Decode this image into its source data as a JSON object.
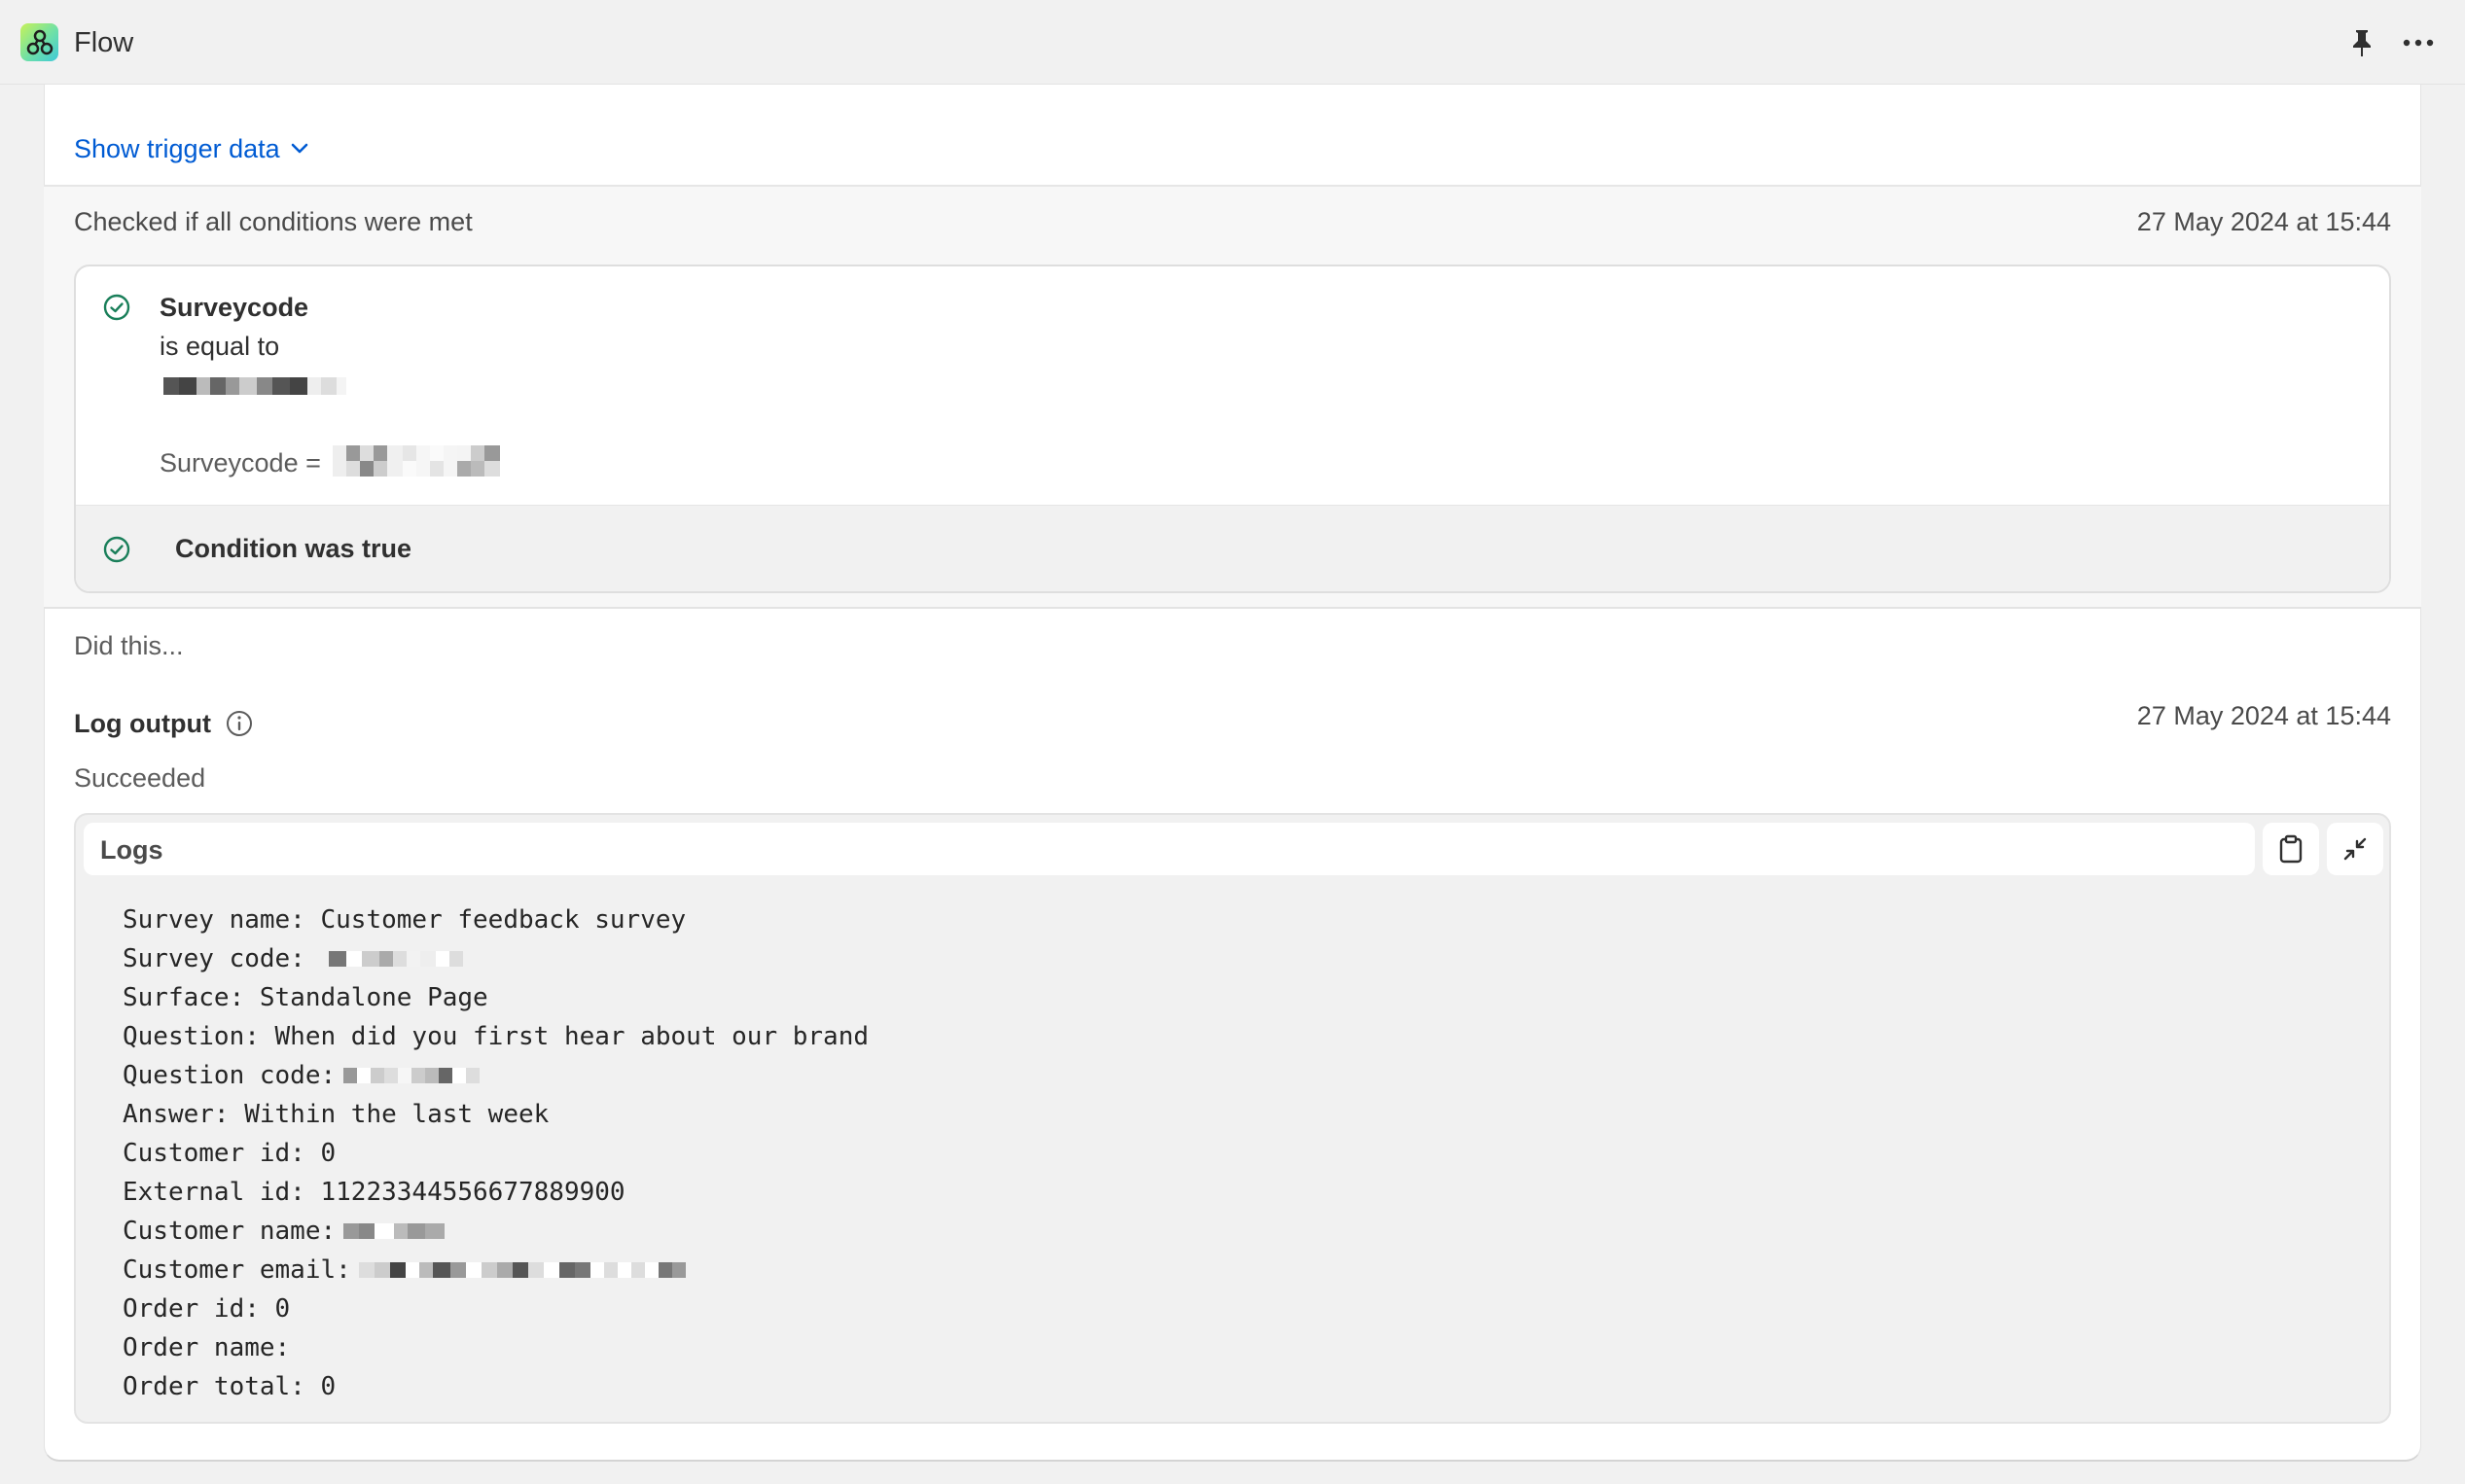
{
  "app": {
    "title": "Flow",
    "icon": "flow-app-icon"
  },
  "header": {
    "pin_icon": "pin-icon",
    "more_icon": "more-horizontal-icon"
  },
  "trigger": {
    "show_label": "Show trigger data"
  },
  "condition_section": {
    "label": "Checked if all conditions were met",
    "timestamp": "27 May 2024 at 15:44",
    "field": "Surveycode",
    "operator": "is equal to",
    "evaluated_prefix": "Surveycode =",
    "result": "Condition was true"
  },
  "action_section": {
    "label": "Did this...",
    "title": "Log output",
    "timestamp": "27 May 2024 at 15:44",
    "status": "Succeeded",
    "logs_label": "Logs",
    "log_lines": [
      {
        "text": "Survey name: Customer feedback survey",
        "redacted": false
      },
      {
        "text": "Survey code: ",
        "redacted": true
      },
      {
        "text": "Surface: Standalone Page",
        "redacted": false
      },
      {
        "text": "Question: When did you first hear about our brand",
        "redacted": false
      },
      {
        "text": "Question code:",
        "redacted": true
      },
      {
        "text": "Answer: Within the last week",
        "redacted": false
      },
      {
        "text": "Customer id: 0",
        "redacted": false
      },
      {
        "text": "External id: 11223344556677889900",
        "redacted": false
      },
      {
        "text": "Customer name:",
        "redacted": true
      },
      {
        "text": "Customer email:",
        "redacted": true
      },
      {
        "text": "Order id: 0",
        "redacted": false
      },
      {
        "text": "Order name:",
        "redacted": false
      },
      {
        "text": "Order total: 0",
        "redacted": false
      }
    ]
  },
  "colors": {
    "link": "#005bd3",
    "success": "#1a7f5a",
    "background": "#f1f1f1",
    "card": "#ffffff"
  }
}
